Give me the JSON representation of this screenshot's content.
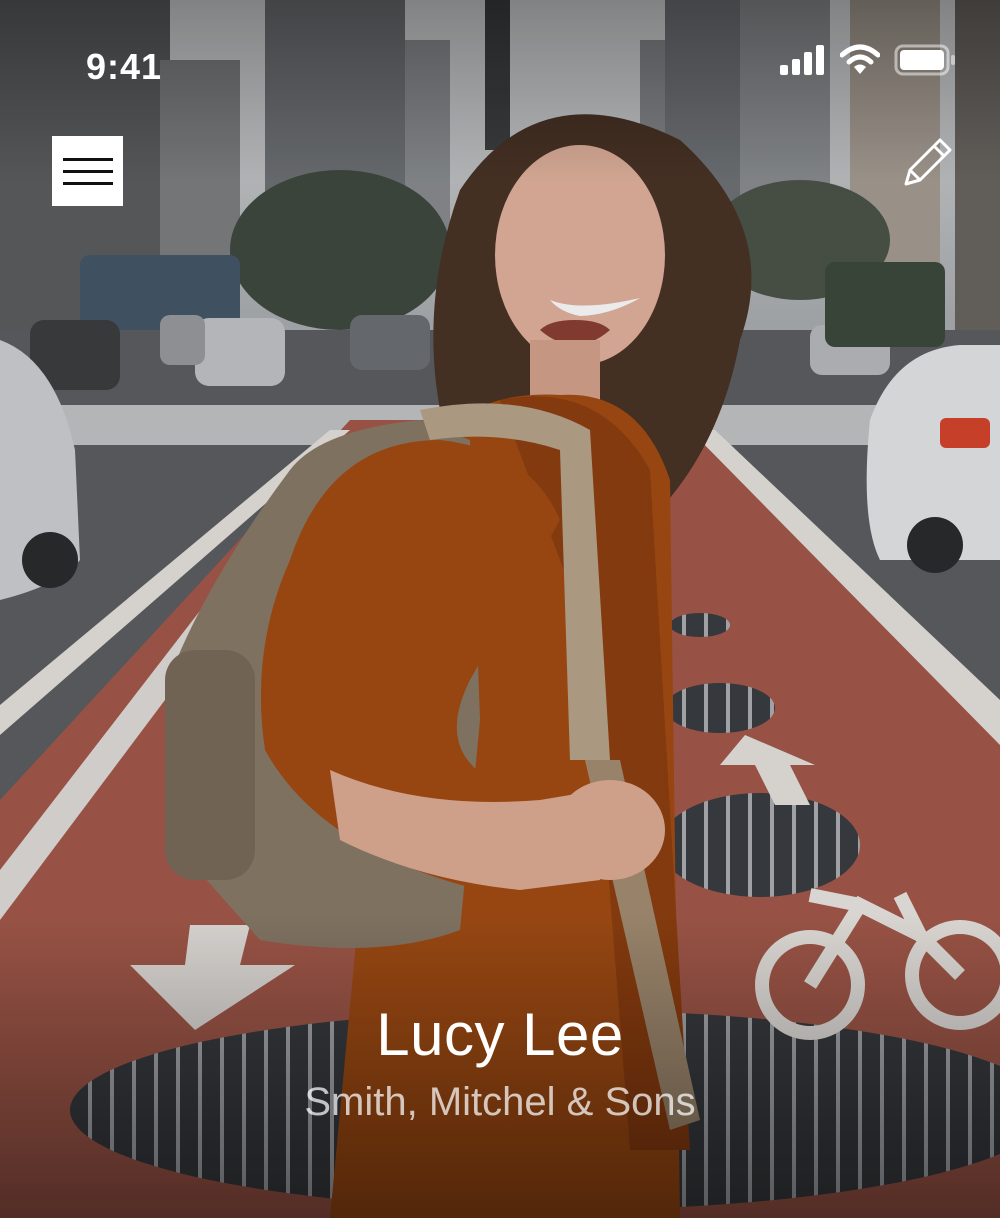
{
  "status_bar": {
    "time": "9:41"
  },
  "icons": {
    "signal": "cellular-signal-icon",
    "wifi": "wifi-icon",
    "battery": "battery-icon",
    "menu": "hamburger-menu-icon",
    "edit": "pencil-icon"
  },
  "profile": {
    "name": "Lucy Lee",
    "company": "Smith, Mitchel & Sons"
  },
  "colors": {
    "bike_lane": "#a55a4b",
    "road": "#5d5f63",
    "shirt": "#a44d14",
    "backpack": "#8a7b69"
  }
}
